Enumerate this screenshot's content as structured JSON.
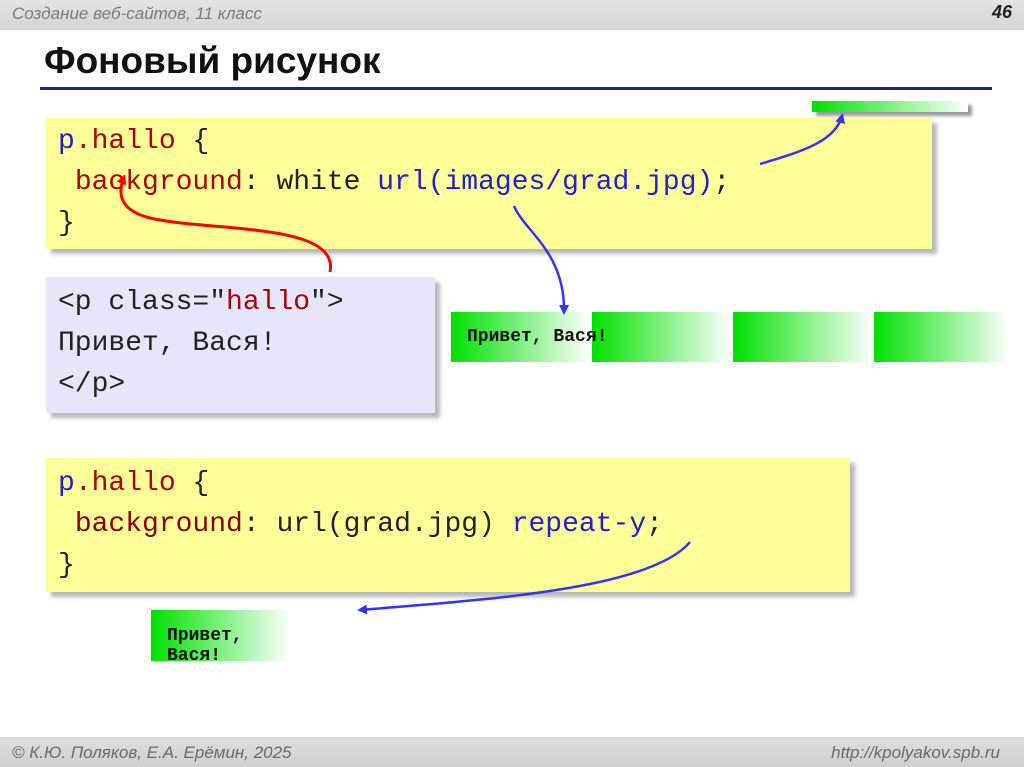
{
  "header": {
    "course": "Создание веб-сайтов, 11 класс",
    "page_number": "46"
  },
  "title": "Фоновый рисунок",
  "css_block_1": {
    "line1": {
      "selector_p": "p",
      "selector_class": ".hallo",
      "brace": " {"
    },
    "line2": {
      "property": "background",
      "colon": ":",
      "value_white": " white ",
      "value_url": "url(images/grad.jpg)",
      "semicolon": ";"
    },
    "line3": "}"
  },
  "html_block": {
    "line1_open": "<p class=\"",
    "line1_class": "hallo",
    "line1_close": "\">",
    "line2": "Привет, Вася!",
    "line3": "</p>"
  },
  "demo_1": {
    "text": "Привет, Вася!",
    "gradient_start": "#00e000",
    "gradient_end": "#ffffff"
  },
  "css_block_2": {
    "line1": {
      "selector_p": "p",
      "selector_class": ".hallo",
      "brace": " {"
    },
    "line2": {
      "property": "background",
      "colon": ":",
      "value_url": " url(grad.jpg) ",
      "value_repeat": "repeat-y",
      "semicolon": ";"
    },
    "line3": "}"
  },
  "demo_2": {
    "text": "Привет, Вася!"
  },
  "footer": {
    "authors": "© К.Ю. Поляков, Е.А. Ерёмин, 2025",
    "site": "http://kpolyakov.spb.ru"
  },
  "colors": {
    "code_bg": "#ffff99",
    "html_bg": "#e6e6fa",
    "arrow_red": "#ff0000",
    "arrow_blue": "#3333ff",
    "rule": "#1f1f9a"
  }
}
